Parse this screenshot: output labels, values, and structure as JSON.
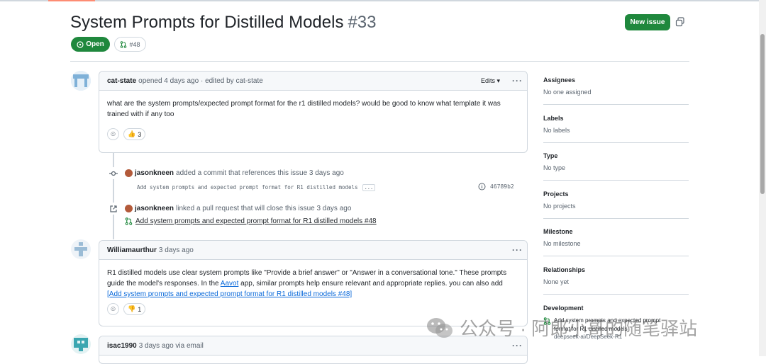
{
  "issue": {
    "title": "System Prompts for Distilled Models",
    "number": "#33",
    "new_issue_label": "New issue",
    "status_label": "Open",
    "linked_pr": "#48"
  },
  "comments": [
    {
      "author": "cat-state",
      "meta": "opened 4 days ago · edited by cat-state",
      "edits_label": "Edits",
      "body": "what are the system prompts/expected prompt format for the r1 distilled models? would be good to know what template it was trained with if any too",
      "reaction_count": "3"
    },
    {
      "author": "Williamaurthur",
      "meta": "3 days ago",
      "body_part1": "R1 distilled models use clear system prompts like \"Provide a brief answer\" or \"Answer in a conversational tone.\" These prompts guide the model's responses. In the ",
      "body_link1": "Aavot",
      "body_part2": " app, similar prompts help ensure relevant and appropriate replies. you can also add ",
      "body_link2": "[Add system prompts and expected prompt format for R1 distilled models #48]",
      "reaction_count": "1"
    },
    {
      "author": "isac1990",
      "meta": "3 days ago via email"
    }
  ],
  "events": {
    "commit": {
      "actor": "jasonkneen",
      "text": "added a commit that references this issue 3 days ago",
      "message": "Add system prompts and expected prompt format for R1 distilled models",
      "more": "...",
      "sha": "46789b2"
    },
    "linked": {
      "actor": "jasonkneen",
      "text": "linked a pull request that will close this issue 3 days ago",
      "pr_title": "Add system prompts and expected prompt format for R1 distilled models #48"
    }
  },
  "sidebar": {
    "assignees": {
      "label": "Assignees",
      "value": "No one assigned"
    },
    "labels": {
      "label": "Labels",
      "value": "No labels"
    },
    "type": {
      "label": "Type",
      "value": "No type"
    },
    "projects": {
      "label": "Projects",
      "value": "No projects"
    },
    "milestone": {
      "label": "Milestone",
      "value": "No milestone"
    },
    "relationships": {
      "label": "Relationships",
      "value": "None yet"
    },
    "development": {
      "label": "Development",
      "pr_line1": "Add system prompts and expected prompt",
      "pr_line2": "format for R1 distilled models",
      "repo": "deepseek-ai/DeepSeek-R1"
    }
  },
  "watermark": {
    "text": "公众号 · 阿郎小哥的随笔驿站"
  },
  "colors": {
    "green": "#1f883d",
    "link": "#0969da",
    "border": "#d0d7de",
    "muted": "#59636e"
  }
}
